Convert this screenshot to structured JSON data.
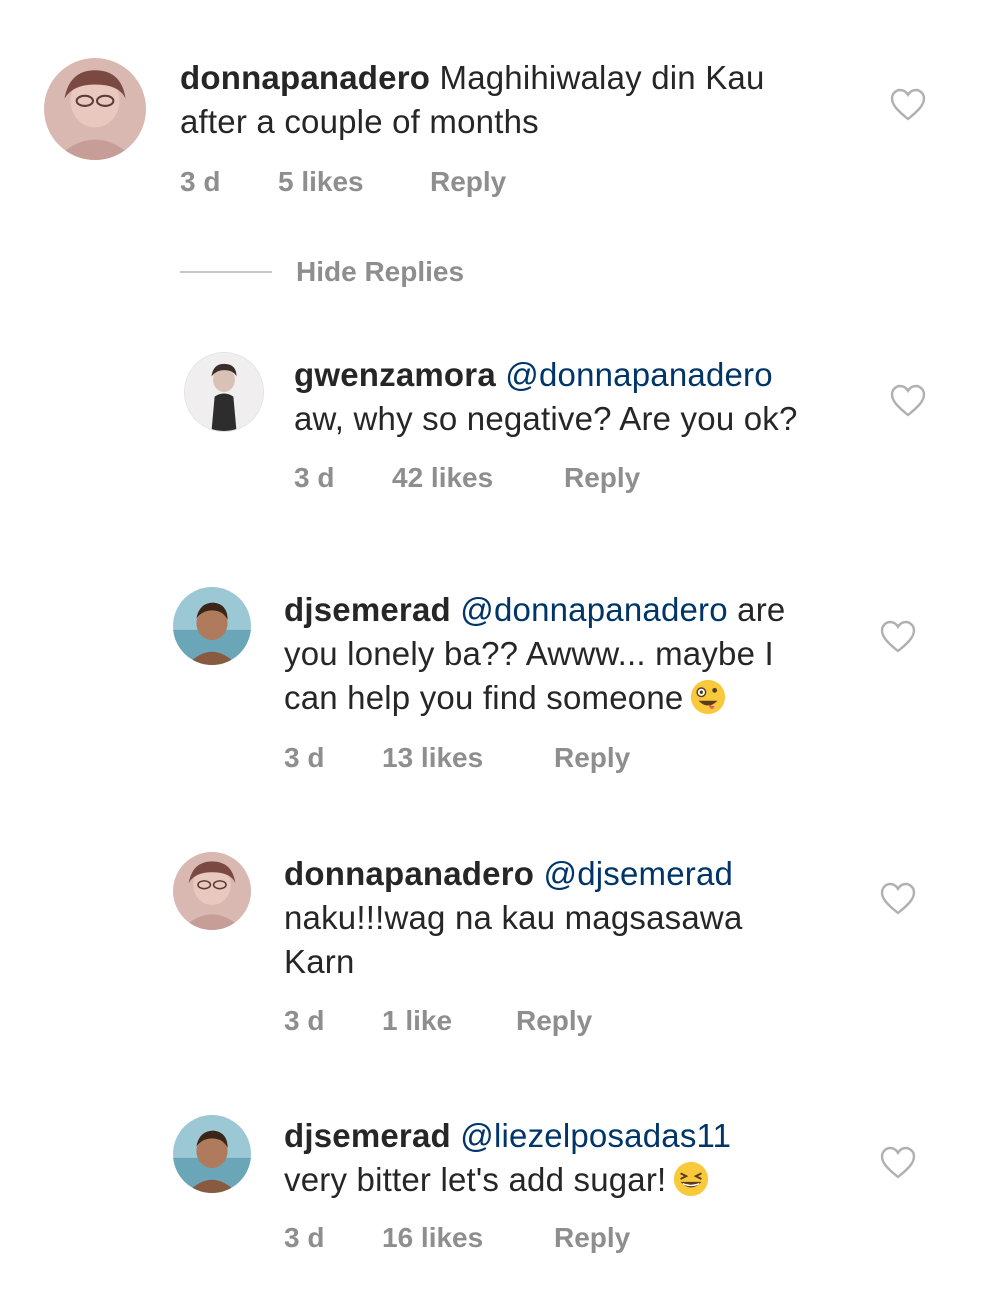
{
  "comments": [
    {
      "username": "donnapanadero",
      "mention": "",
      "lines": [
        "Maghihiwalay din Kau",
        "after a couple of months"
      ],
      "time": "3 d",
      "likes": "5 likes",
      "reply": "Reply",
      "avatar_icon": "user-avatar-donnapanadero"
    },
    {
      "username": "gwenzamora",
      "mention": "@donnapanadero",
      "lines": [
        "",
        "aw, why so negative? Are you ok?"
      ],
      "time": "3 d",
      "likes": "42 likes",
      "reply": "Reply",
      "avatar_icon": "user-avatar-gwenzamora"
    },
    {
      "username": "djsemerad",
      "mention": "@donnapanadero",
      "lines": [
        "are",
        "you lonely ba?? Awww... maybe I",
        "can help you find someone"
      ],
      "time": "3 d",
      "likes": "13 likes",
      "reply": "Reply",
      "emoji": "crazy-face-emoji",
      "avatar_icon": "user-avatar-djsemerad"
    },
    {
      "username": "donnapanadero",
      "mention": "@djsemerad",
      "lines": [
        "",
        "naku!!!wag na kau magsasawa",
        "Karn"
      ],
      "time": "3 d",
      "likes": "1 like",
      "reply": "Reply",
      "avatar_icon": "user-avatar-donnapanadero"
    },
    {
      "username": "djsemerad",
      "mention": "@liezelposadas11",
      "lines": [
        "",
        "very bitter let's add sugar!"
      ],
      "time": "3 d",
      "likes": "16 likes",
      "reply": "Reply",
      "emoji": "grinning-squinting-emoji",
      "avatar_icon": "user-avatar-djsemerad"
    }
  ],
  "hide_replies": "Hide Replies",
  "icons": {
    "like": "heart-outline-icon"
  },
  "colors": {
    "text": "#262626",
    "meta": "#8e8e8e",
    "mention": "#003569"
  }
}
